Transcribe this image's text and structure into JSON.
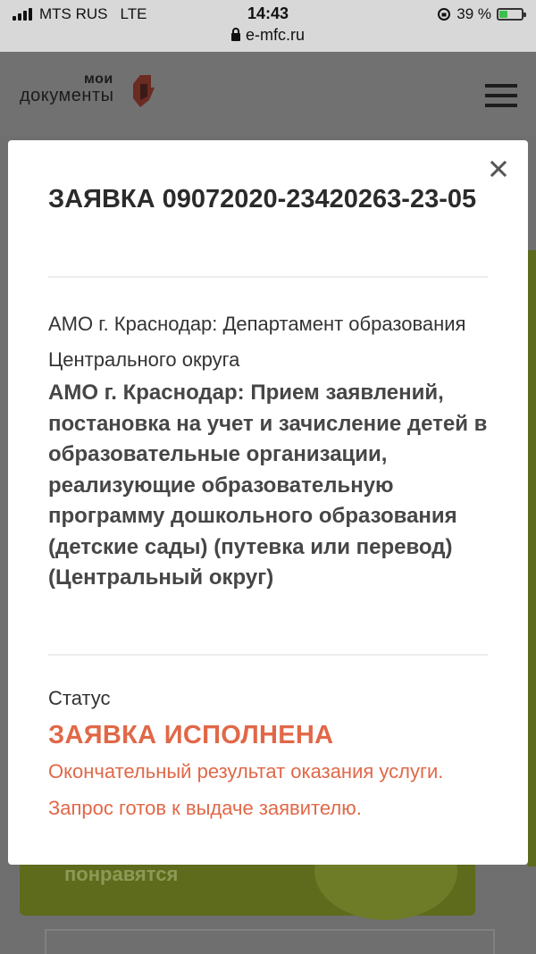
{
  "status_bar": {
    "carrier": "MTS RUS",
    "network": "LTE",
    "time": "14:43",
    "battery": "39 %",
    "battery_level": 0.39,
    "url": "e-mfc.ru"
  },
  "site": {
    "logo_line1": "мои",
    "logo_line2": "документы",
    "banner_text": "понравятся"
  },
  "modal": {
    "title": "ЗАЯВКА 09072020-23420263-23-05",
    "department": "АМО г. Краснодар: Департамент образования Центрального округа",
    "service": "АМО г. Краснодар: Прием заявлений, постановка на учет и зачисление детей в образовательные организации, реализующие образовательную программу дошкольного образования (детские сады) (путевка или перевод) (Центральный округ)",
    "status_label": "Статус",
    "status_value": "ЗАЯВКА ИСПОЛНЕНА",
    "status_description": "Окончательный результат оказания услуги. Запрос готов к выдаче заявителю."
  },
  "colors": {
    "status_accent": "#e06848",
    "overlay": "#6f6f6f",
    "logo_red": "#c0392b"
  }
}
